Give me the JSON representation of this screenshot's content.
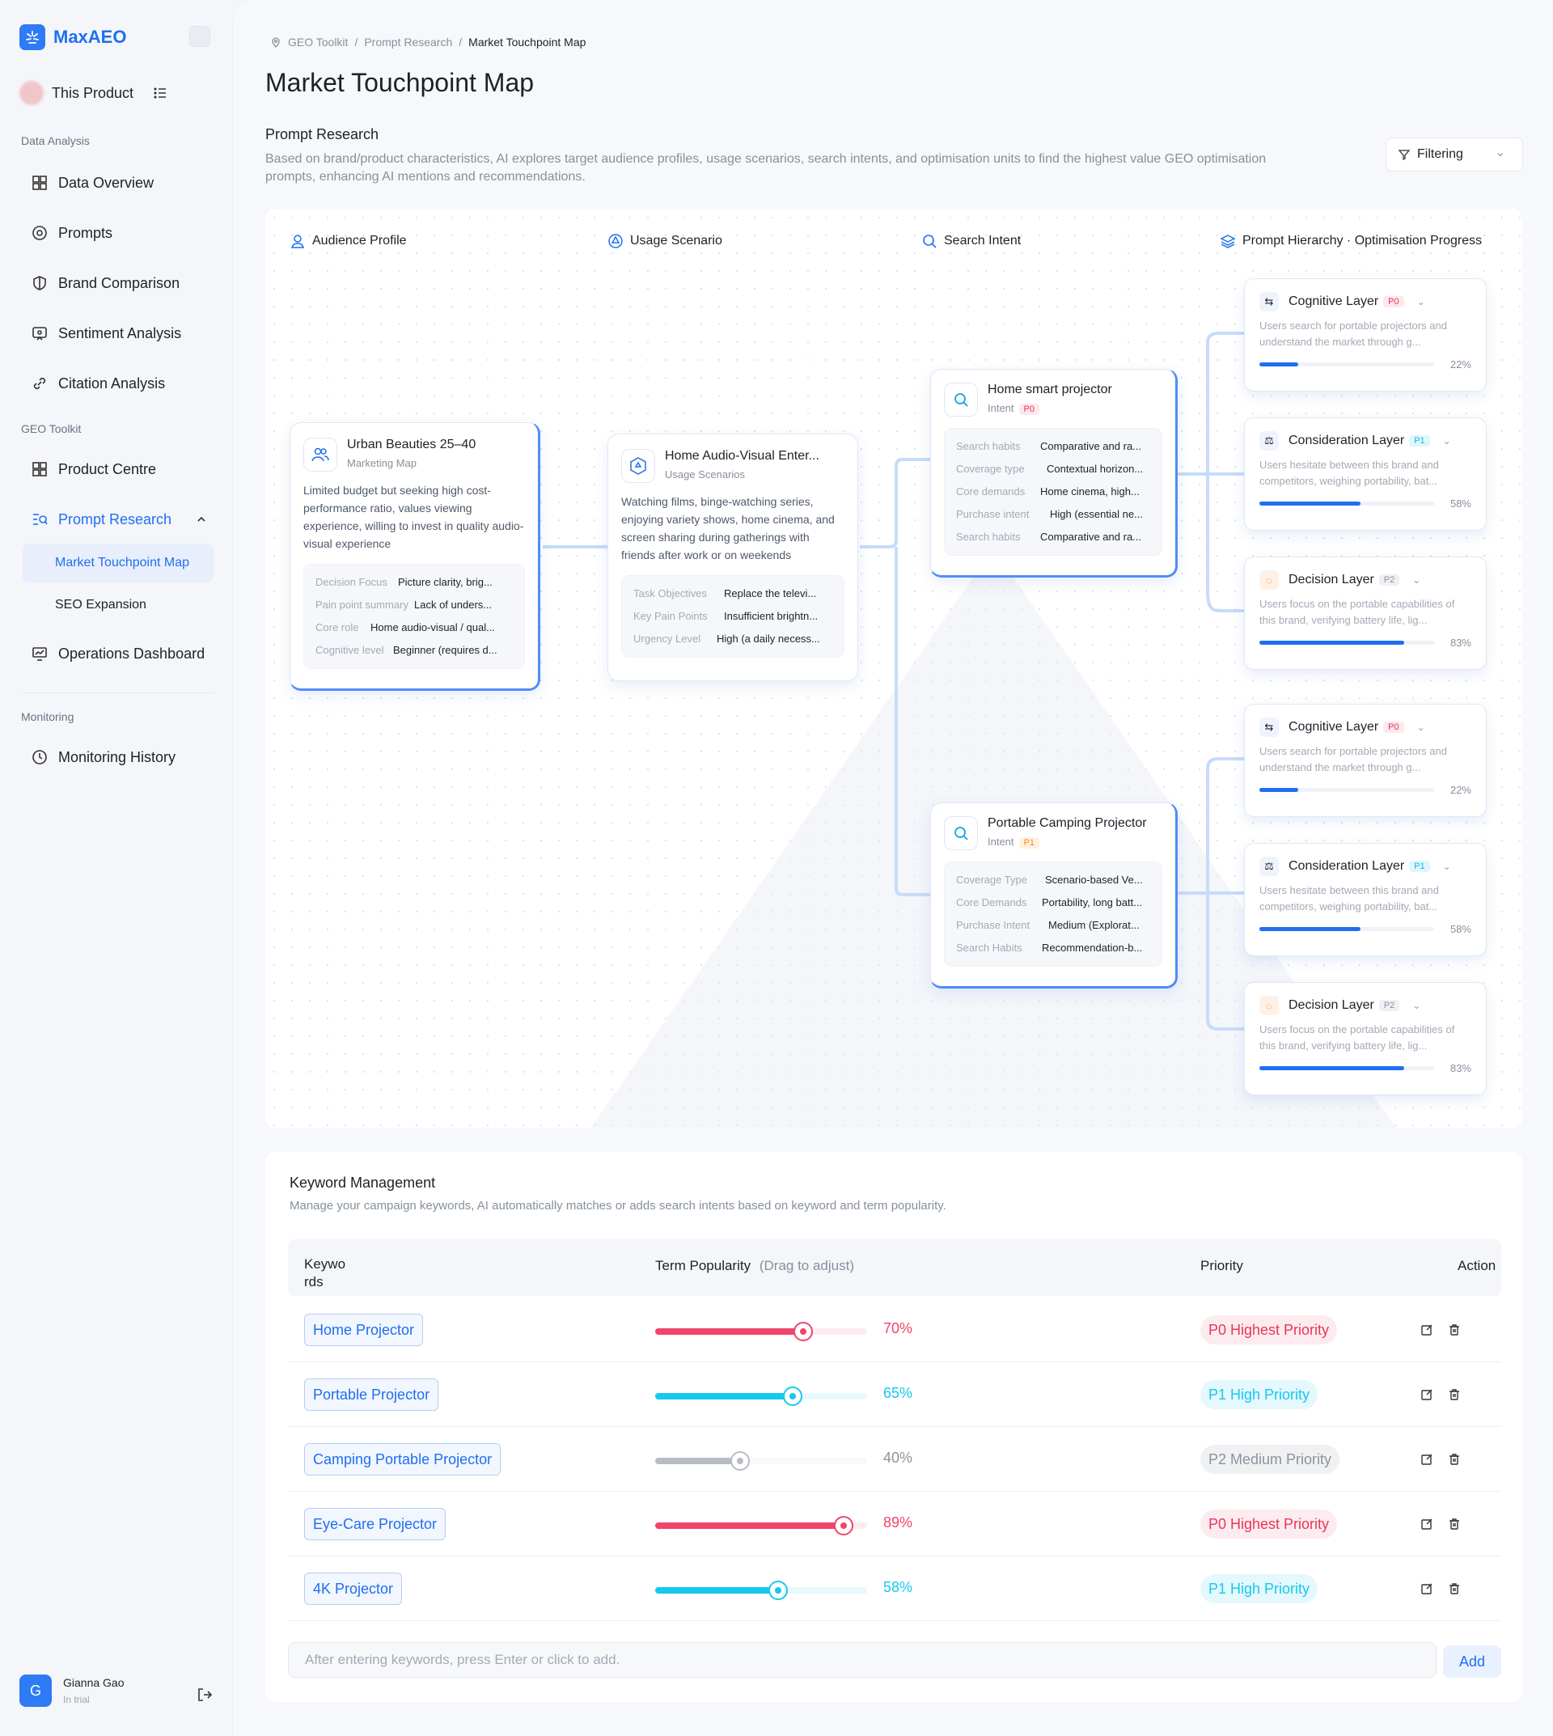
{
  "app": {
    "name": "MaxAEO",
    "product": "This Product"
  },
  "sidebar": {
    "sections": [
      "Data Analysis",
      "GEO Toolkit",
      "Monitoring"
    ],
    "items": [
      {
        "label": "Data Overview",
        "icon": "dashboard-icon"
      },
      {
        "label": "Prompts",
        "icon": "prompts-icon"
      },
      {
        "label": "Brand Comparison",
        "icon": "shield-icon"
      },
      {
        "label": "Sentiment Analysis",
        "icon": "sentiment-icon"
      },
      {
        "label": "Citation Analysis",
        "icon": "link-icon"
      },
      {
        "label": "Product Centre",
        "icon": "grid-icon"
      },
      {
        "label": "Prompt Research",
        "icon": "research-icon"
      },
      {
        "label": "Operations Dashboard",
        "icon": "monitor-icon"
      },
      {
        "label": "Monitoring History",
        "icon": "clock-icon"
      }
    ],
    "subitems": [
      "Market Touchpoint Map",
      "SEO Expansion"
    ],
    "user": {
      "initial": "G",
      "name": "Gianna Gao",
      "status": "In trial"
    }
  },
  "breadcrumb": [
    "GEO Toolkit",
    "Prompt Research",
    "Market Touchpoint Map"
  ],
  "page_title": "Market Touchpoint Map",
  "research": {
    "heading": "Prompt Research",
    "description": "Based on brand/product characteristics, AI explores target audience profiles, usage scenarios, search intents, and optimisation units to find the highest value GEO optimisation prompts, enhancing AI mentions and recommendations.",
    "filter_label": "Filtering"
  },
  "columns": [
    "Audience Profile",
    "Usage Scenario",
    "Search Intent",
    "Prompt Hierarchy · Optimisation Progress"
  ],
  "audience": {
    "title": "Urban Beauties 25–40",
    "subtitle": "Marketing Map",
    "text": "Limited budget but seeking high cost-performance ratio, values viewing experience, willing to invest in quality audio-visual experience",
    "kv": [
      [
        "Decision Focus",
        "Picture clarity, brig..."
      ],
      [
        "Pain point summary",
        "Lack of unders..."
      ],
      [
        "Core role",
        "Home audio-visual / qual..."
      ],
      [
        "Cognitive level",
        "Beginner (requires d..."
      ]
    ]
  },
  "scenario": {
    "title": "Home Audio-Visual Enter...",
    "subtitle": "Usage Scenarios",
    "text": "Watching films, binge-watching series, enjoying variety shows, home cinema, and screen sharing during gatherings with friends after work or on weekends",
    "kv": [
      [
        "Task Objectives",
        "Replace the televi..."
      ],
      [
        "Key Pain Points",
        "Insufficient brightn..."
      ],
      [
        "Urgency Level",
        "High (a daily necess..."
      ]
    ]
  },
  "intents": [
    {
      "title": "Home smart projector",
      "subtitle": "Intent",
      "tag": "P0",
      "kv": [
        [
          "Search habits",
          "Comparative and ra..."
        ],
        [
          "Coverage type",
          "Contextual horizon..."
        ],
        [
          "Core demands",
          "Home cinema, high..."
        ],
        [
          "Purchase intent",
          "High (essential ne..."
        ],
        [
          "Search habits",
          "Comparative and ra..."
        ]
      ]
    },
    {
      "title": "Portable Camping Projector",
      "subtitle": "Intent",
      "tag": "P1",
      "kv": [
        [
          "Coverage Type",
          "Scenario-based Ve..."
        ],
        [
          "Core Demands",
          "Portability, long batt..."
        ],
        [
          "Purchase Intent",
          "Medium (Explorat..."
        ],
        [
          "Search Habits",
          "Recommendation-b..."
        ]
      ]
    }
  ],
  "layers": [
    {
      "name": "Cognitive Layer",
      "tag": "P0",
      "desc": "Users search for portable projectors and understand the market through g...",
      "progress": 22
    },
    {
      "name": "Consideration Layer",
      "tag": "P1",
      "desc": "Users hesitate between this brand and competitors, weighing portability, bat...",
      "progress": 58
    },
    {
      "name": "Decision Layer",
      "tag": "P2",
      "desc": "Users focus on the portable capabilities of this brand, verifying battery life, lig...",
      "progress": 83
    },
    {
      "name": "Cognitive Layer",
      "tag": "P0",
      "desc": "Users search for portable projectors and understand the market through g...",
      "progress": 22
    },
    {
      "name": "Consideration Layer",
      "tag": "P1",
      "desc": "Users hesitate between this brand and competitors, weighing portability, bat...",
      "progress": 58
    },
    {
      "name": "Decision Layer",
      "tag": "P2",
      "desc": "Users focus on the portable capabilities of this brand, verifying battery life, lig...",
      "progress": 83
    }
  ],
  "keywords": {
    "title": "Keyword Management",
    "description": "Manage your campaign keywords, AI automatically matches or adds search intents based on keyword and term popularity.",
    "headers": {
      "keyword": "Keywo rds",
      "popularity": "Term Popularity",
      "hint": "(Drag to adjust)",
      "priority": "Priority",
      "action": "Action"
    },
    "rows": [
      {
        "keyword": "Home Projector",
        "popularity": 70,
        "pct": "70%",
        "priority": "P0 Highest Priority",
        "color": "#f0446a"
      },
      {
        "keyword": "Portable Projector",
        "popularity": 65,
        "pct": "65%",
        "priority": "P1 High Priority",
        "color": "#16c8ef"
      },
      {
        "keyword": "Camping Portable Projector",
        "popularity": 40,
        "pct": "40%",
        "priority": "P2 Medium Priority",
        "color": "#b8bcc4"
      },
      {
        "keyword": "Eye-Care Projector",
        "popularity": 89,
        "pct": "89%",
        "priority": "P0 Highest Priority",
        "color": "#f0446a"
      },
      {
        "keyword": "4K Projector",
        "popularity": 58,
        "pct": "58%",
        "priority": "P1 High Priority",
        "color": "#16c8ef"
      }
    ],
    "input_placeholder": "After entering keywords, press Enter or click to add.",
    "add_label": "Add"
  }
}
